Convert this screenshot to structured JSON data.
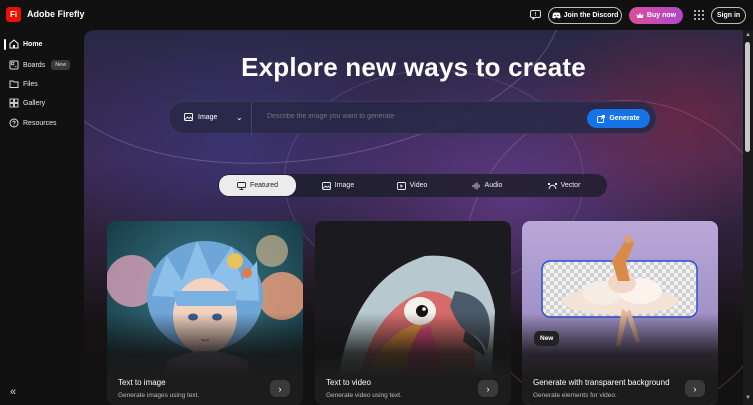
{
  "header": {
    "logo_text": "Fi",
    "app_title": "Adobe Firefly",
    "discord_label": "Join the Discord",
    "buy_label": "Buy now",
    "signin_label": "Sign in",
    "icons": [
      "feedback-icon",
      "discord-icon",
      "crown-icon",
      "apps-grid-icon"
    ]
  },
  "sidebar": {
    "items": [
      {
        "label": "Home",
        "icon": "home-icon",
        "active": true
      },
      {
        "label": "Boards",
        "icon": "boards-icon",
        "badge": "New"
      },
      {
        "label": "Files",
        "icon": "folder-icon"
      },
      {
        "label": "Gallery",
        "icon": "gallery-icon"
      },
      {
        "label": "Resources",
        "icon": "help-icon"
      }
    ],
    "collapse_glyph": "«"
  },
  "hero": {
    "title": "Explore new ways to create"
  },
  "prompt": {
    "type_label": "Image",
    "placeholder": "Describe the image you want to generate",
    "generate_label": "Generate"
  },
  "tabs": [
    {
      "label": "Featured",
      "icon": "featured-icon",
      "active": true
    },
    {
      "label": "Image",
      "icon": "image-icon"
    },
    {
      "label": "Video",
      "icon": "video-icon"
    },
    {
      "label": "Audio",
      "icon": "audio-icon"
    },
    {
      "label": "Vector",
      "icon": "vector-icon"
    }
  ],
  "cards": [
    {
      "title": "Text to image",
      "subtitle": "Generate images using text."
    },
    {
      "title": "Text to video",
      "subtitle": "Generate video using text."
    },
    {
      "title": "Generate with transparent background",
      "subtitle": "Generate elements for video.",
      "badge": "New"
    }
  ],
  "colors": {
    "accent_blue": "#1473e6",
    "adobe_red": "#eb1000",
    "buy_gradient_start": "#d94e9c",
    "buy_gradient_end": "#b048c7"
  }
}
